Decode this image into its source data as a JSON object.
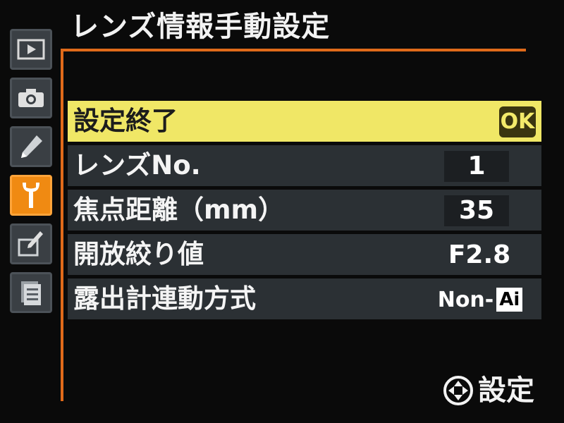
{
  "header": {
    "title": "レンズ情報手動設定"
  },
  "tabs": [
    {
      "name": "playback",
      "icon": "play-icon"
    },
    {
      "name": "shooting",
      "icon": "camera-icon"
    },
    {
      "name": "custom",
      "icon": "pencil-icon"
    },
    {
      "name": "setup",
      "icon": "wrench-icon",
      "active": true
    },
    {
      "name": "retouch",
      "icon": "retouch-brush-icon"
    },
    {
      "name": "recent",
      "icon": "document-list-icon"
    }
  ],
  "menu": {
    "items": [
      {
        "label": "設定終了",
        "value": "OK",
        "selected": true
      },
      {
        "label": "レンズNo.",
        "value": "1"
      },
      {
        "label": "焦点距離（mm）",
        "value": "35"
      },
      {
        "label": "開放絞り値",
        "value": "F2.8"
      },
      {
        "label": "露出計連動方式",
        "value_prefix": "Non-",
        "value_box": "Ai"
      }
    ]
  },
  "footer": {
    "icon": "multi-selector-icon",
    "label": "設定"
  },
  "colors": {
    "accent": "#e06a1a",
    "active_tab": "#f08a12",
    "selected_row": "#f0e766",
    "row_bg": "#2b3034",
    "background": "#0a0a0a"
  }
}
